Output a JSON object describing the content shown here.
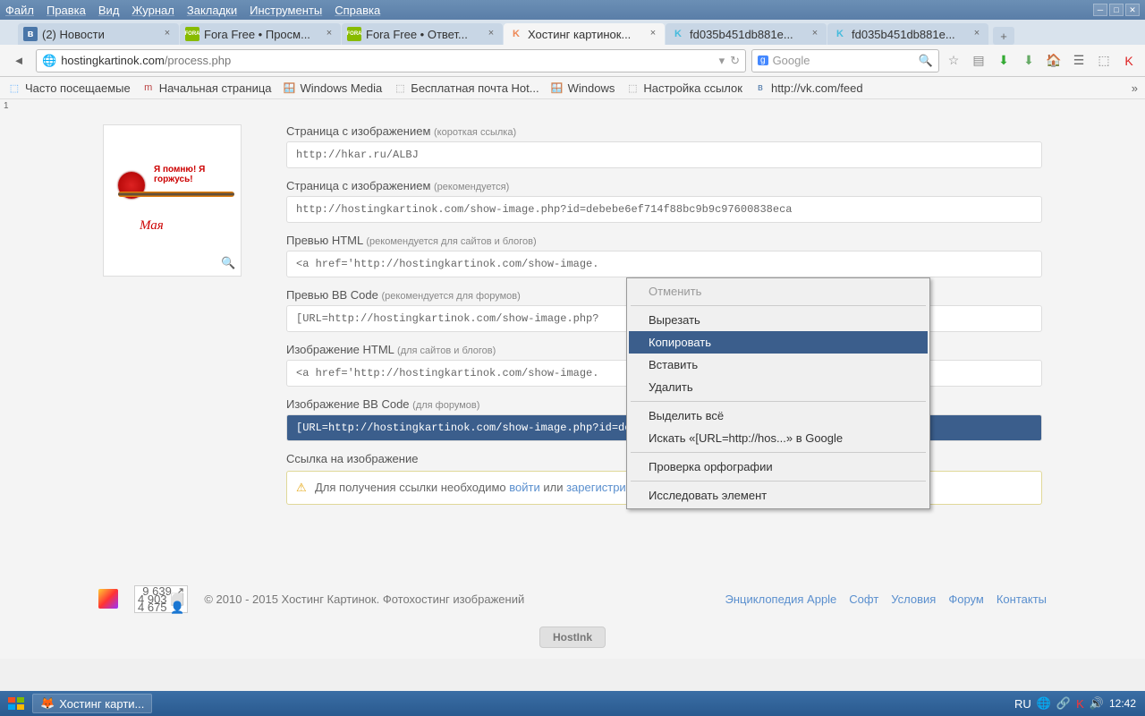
{
  "menu": {
    "file": "Файл",
    "edit": "Правка",
    "view": "Вид",
    "journal": "Журнал",
    "bookmarks": "Закладки",
    "tools": "Инструменты",
    "help": "Справка"
  },
  "tabs": [
    {
      "title": "(2) Новости",
      "fav": "в",
      "favbg": "#4a76a8",
      "favcolor": "#fff"
    },
    {
      "title": "Fora Free • Просм...",
      "fav": "FORA",
      "favbg": "#8b0",
      "favcolor": "#fff"
    },
    {
      "title": "Fora Free • Ответ...",
      "fav": "FORA",
      "favbg": "#8b0",
      "favcolor": "#fff"
    },
    {
      "title": "Хостинг картинок...",
      "fav": "K",
      "favbg": "transparent",
      "favcolor": "#e85",
      "active": true
    },
    {
      "title": "fd035b451db881e...",
      "fav": "K",
      "favbg": "transparent",
      "favcolor": "#4bd"
    },
    {
      "title": "fd035b451db881e...",
      "fav": "K",
      "favbg": "transparent",
      "favcolor": "#4bd"
    }
  ],
  "url": {
    "host": "hostingkartinok.com",
    "path": "/process.php"
  },
  "search": {
    "placeholder": "Google",
    "engine": "g"
  },
  "bookmarks": [
    "Часто посещаемые",
    "Начальная страница",
    "Windows Media",
    "Бесплатная почта Hot...",
    "Windows",
    "Настройка ссылок",
    "http://vk.com/feed"
  ],
  "thumb": {
    "line1": "Я помню! Я горжусь!",
    "line2": "Мая"
  },
  "fields": [
    {
      "label": "Страница с изображением",
      "sub": "(короткая ссылка)",
      "value": "http://hkar.ru/ALBJ"
    },
    {
      "label": "Страница с изображением",
      "sub": "(рекомендуется)",
      "value": "http://hostingkartinok.com/show-image.php?id=debebe6ef714f88bc9b9c97600838eca"
    },
    {
      "label": "Превью HTML",
      "sub": "(рекомендуется для сайтов и блогов)",
      "value": "<a href='http://hostingkartinok.com/show-image."
    },
    {
      "label": "Превью BB Code",
      "sub": "(рекомендуется для форумов)",
      "value": "[URL=http://hostingkartinok.com/show-image.php?"
    },
    {
      "label": "Изображение HTML",
      "sub": "(для сайтов и блогов)",
      "value": "<a href='http://hostingkartinok.com/show-image."
    },
    {
      "label": "Изображение BB Code",
      "sub": "(для форумов)",
      "value": "[URL=http://hostingkartinok.com/show-image.php?id=debebe6ef714f88bc9b9c97600838eca][IMG]ht",
      "selected": true
    }
  ],
  "linksection": {
    "label": "Ссылка на изображение",
    "text_pre": "Для получения ссылки необходимо ",
    "login": "войти",
    "or": " или ",
    "register": "зарегистрироваться",
    "dot": "."
  },
  "context": {
    "undo": "Отменить",
    "cut": "Вырезать",
    "copy": "Копировать",
    "paste": "Вставить",
    "delete": "Удалить",
    "selectall": "Выделить всё",
    "search": "Искать «[URL=http://hos...» в Google",
    "spell": "Проверка орфографии",
    "inspect": "Исследовать элемент"
  },
  "footer": {
    "counter": {
      "l1": "9 639 ↗",
      "l2": "4 903 ⬜",
      "l3": "4 675 👤"
    },
    "copyright": "© 2010 - 2015 Хостинг Картинок. Фотохостинг изображений",
    "links": [
      "Энциклопедия Apple",
      "Софт",
      "Условия",
      "Форум",
      "Контакты"
    ],
    "hostink": "HostInk"
  },
  "taskbar": {
    "app": "Хостинг карти...",
    "lang": "RU",
    "time": "12:42"
  },
  "corner": "1"
}
